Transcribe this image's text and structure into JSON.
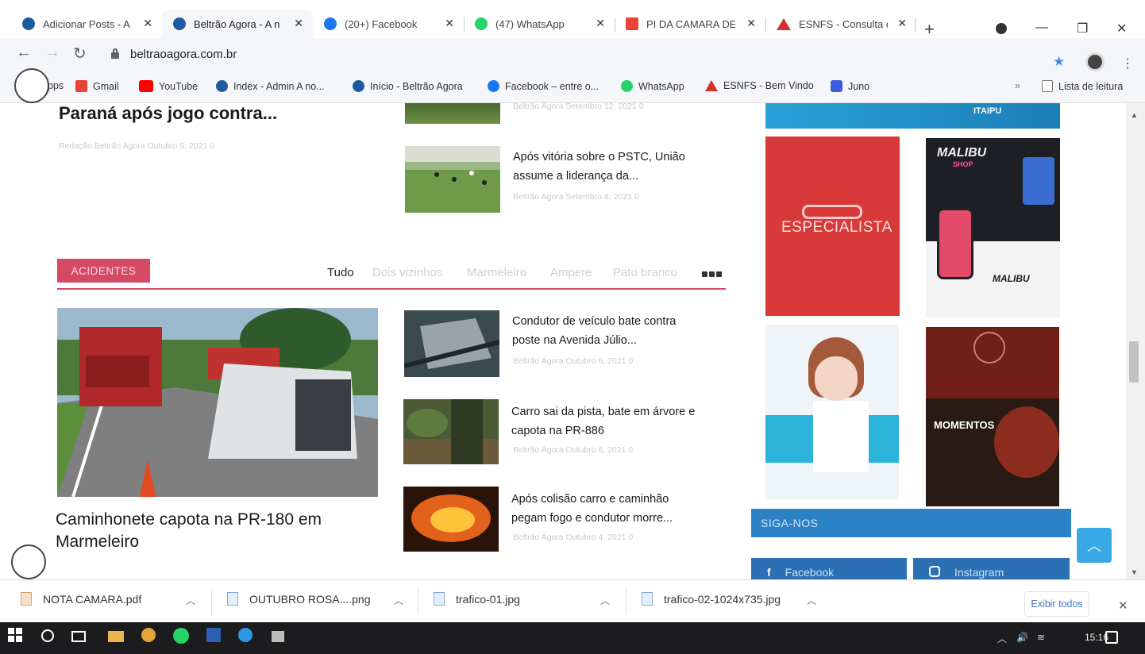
{
  "tabs": [
    {
      "title": "Adicionar Posts - A",
      "icon": "wordpress-icon",
      "color": "#1e5aa0",
      "active": false
    },
    {
      "title": "Beltrão Agora - A n",
      "icon": "wordpress-icon",
      "color": "#1e5aa0",
      "active": true
    },
    {
      "title": "(20+) Facebook",
      "icon": "facebook-icon",
      "color": "#1877f2",
      "active": false
    },
    {
      "title": "(47) WhatsApp",
      "icon": "whatsapp-icon",
      "color": "#25d366",
      "active": false
    },
    {
      "title": "PI DA CAMARA DE",
      "icon": "gmail-icon",
      "color": "#ea4335",
      "active": false
    },
    {
      "title": "ESNFS - Consulta d",
      "icon": "esnfs-icon",
      "color": "#d9302c",
      "active": false
    }
  ],
  "address": {
    "url": "beltraoagora.com.br"
  },
  "bookmarks": [
    {
      "label": "pps",
      "icon": "apps-icon"
    },
    {
      "label": "Gmail",
      "icon": "gmail-icon",
      "color": "#ea4335"
    },
    {
      "label": "YouTube",
      "icon": "youtube-icon",
      "color": "#ff0000"
    },
    {
      "label": "Index - Admin A no...",
      "icon": "wordpress-icon",
      "color": "#1e5aa0"
    },
    {
      "label": "Início - Beltrão Agora",
      "icon": "wordpress-icon",
      "color": "#1e5aa0"
    },
    {
      "label": "Facebook – entre o...",
      "icon": "facebook-icon",
      "color": "#1877f2"
    },
    {
      "label": "WhatsApp",
      "icon": "whatsapp-icon",
      "color": "#25d366"
    },
    {
      "label": "ESNFS - Bem Vindo",
      "icon": "esnfs-icon",
      "color": "#d9302c"
    },
    {
      "label": "Juno",
      "icon": "juno-icon",
      "color": "#3b5bdb"
    }
  ],
  "reading_list": "Lista de leitura",
  "top_story": {
    "title": "Paraná após jogo contra...",
    "meta": "Redação Beltrão Agora  Outubro 5, 2021  0"
  },
  "side_top": [
    {
      "title": "",
      "meta": "Beltrão Agora  Setembro 12, 2021  0"
    },
    {
      "title_line1": "Após vitória sobre o PSTC, União",
      "title_line2": "assume a liderança da...",
      "meta": "Beltrão Agora  Setembro 8, 2021  0"
    }
  ],
  "section": {
    "label": "ACIDENTES",
    "filters": [
      "Tudo",
      "Dois vizinhos",
      "Marmeleiro",
      "Ampere",
      "Pato branco"
    ]
  },
  "main_story": {
    "title_line1": "Caminhonete capota na PR-180 em",
    "title_line2": "Marmeleiro"
  },
  "side_stories": [
    {
      "title_line1": "Condutor de veículo bate contra",
      "title_line2": "poste na Avenida Júlio...",
      "meta": "Beltrão Agora  Outubro 6, 2021  0"
    },
    {
      "title_line1": "Carro sai da pista, bate em árvore e",
      "title_line2": "capota na PR-886",
      "meta": "Beltrão Agora  Outubro 6, 2021  0"
    },
    {
      "title_line1": "Após colisão carro e caminhão",
      "title_line2": "pegam fogo e condutor morre...",
      "meta": "Beltrão Agora  Outubro 4, 2021  0"
    }
  ],
  "ads": {
    "itaipu": "ITAIPU",
    "otica": "ESPECIALISTA",
    "malibu_top": "MALIBU",
    "malibu_sub": "SHOP",
    "malibu_bottom": "MALIBU",
    "restaurant": "MOMENTOS"
  },
  "siga": "SIGA-NOS",
  "social": [
    "Facebook",
    "Instagram"
  ],
  "downloads": [
    {
      "name": "NOTA CAMARA.pdf",
      "type": "pdf"
    },
    {
      "name": "OUTUBRO ROSA....png",
      "type": "image"
    },
    {
      "name": "trafico-01.jpg",
      "type": "image"
    },
    {
      "name": "trafico-02-1024x735.jpg",
      "type": "image"
    }
  ],
  "show_all": "Exibir todos",
  "clock": "15:16"
}
